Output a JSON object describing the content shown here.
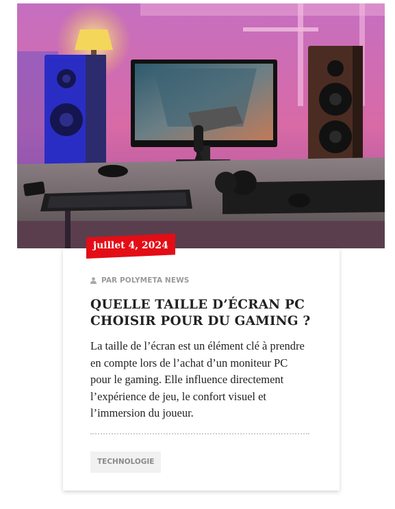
{
  "article": {
    "date": "juillet 4, 2024",
    "author": "PAR POLYMETA NEWS",
    "title": "QUELLE TAILLE D’ÉCRAN PC CHOISIR POUR DU GAMING ?",
    "excerpt": "La taille de l’écran est un élément clé à prendre en compte lors de l’achat d’un moniteur PC pour le gaming. Elle influence directement l’expérience de jeu, le confort visuel et l’immersion du joueur.",
    "category": "TECHNOLOGIE",
    "image": {
      "subject": "gaming desk setup with monitor, speakers, keyboard, mouse and headphones"
    }
  },
  "icons": {
    "author": "user-icon"
  },
  "colors": {
    "date_badge": "#e30d16",
    "tag_background": "#f1f1f1",
    "meta_text": "#9a9a9a",
    "body_text": "#222222"
  }
}
